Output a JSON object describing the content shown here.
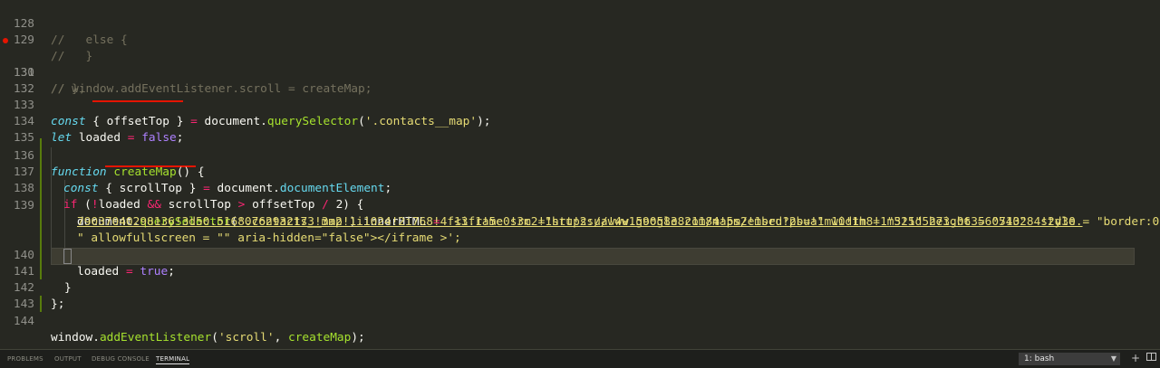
{
  "editor": {
    "gutter": [
      "128",
      "129",
      "130",
      "131",
      "132",
      "133",
      "134",
      "135",
      "136",
      "137",
      "138",
      "139",
      "",
      "",
      "140",
      "141",
      "142",
      "143",
      "144"
    ],
    "lines": {
      "l128": "//   else {",
      "l129": "//   }",
      "l130": "// };",
      "l131": "// window.addEventListener.scroll = createMap;",
      "l133": {
        "kw": "const",
        "open": " { ",
        "name": "offsetTop",
        "close": " } ",
        "eq": "=",
        "obj": " document.",
        "method": "querySelector",
        "p1": "(",
        "arg": "'.contacts__map'",
        "p2": ");"
      },
      "l134": {
        "kw": "let",
        "name": " loaded ",
        "eq": "=",
        "sp": " ",
        "val": "false",
        "end": ";"
      },
      "l136": {
        "kw": "function",
        "sp": " ",
        "name": "createMap",
        "rest": "() {"
      },
      "l137": {
        "kw": "const",
        "open": " { ",
        "name": "scrollTop",
        "close": " } ",
        "eq": "=",
        "obj": " document.",
        "prop": "documentElement",
        "end": ";"
      },
      "l138": {
        "kw": "if",
        "p": " (",
        "not": "!",
        "a": "loaded ",
        "and": "&&",
        "b": " scrollTop ",
        "gt": ">",
        "c": " offsetTop ",
        "div": "/",
        "d": " 2) {"
      },
      "l139a": {
        "obj": "document.",
        "method": "querySelector",
        "p1": "(",
        "arg": "'.contacts__map'",
        "p2": ").innerHTML ",
        "eq": "=",
        "sp": " ",
        "s1": "'<iframe src =\"",
        "url1": "https://www.google.com/maps/embed?pb=!1m10!1m8!1m3!1d5273.063560713284!2d30."
      },
      "l139b": {
        "url2": "79037040298136!3d50.51680762932173!3m2!1i1024!2i768!4f13.1!5e0!3m2!1sru!2sua!4v1590583821184!5m2!1sru!2sua",
        "s2": "\" width = \"525\" height = \"540\"  style = \"border:0;"
      },
      "l139c": "\" allowfullscreen = \"\" aria-hidden=\"false\"></iframe >';",
      "l140": {
        "name": "loaded ",
        "eq": "=",
        "sp": " ",
        "val": "true",
        "end": ";"
      },
      "l141": "}",
      "l142": "};",
      "l144": {
        "obj": "window.",
        "method": "addEventListener",
        "p1": "(",
        "arg": "'scroll'",
        "mid": ", ",
        "fn": "createMap",
        "end": ");"
      }
    }
  },
  "panel": {
    "tabs": [
      "PROBLEMS",
      "OUTPUT",
      "DEBUG CONSOLE",
      "TERMINAL"
    ],
    "active_tab": "TERMINAL",
    "terminal_select": "1: bash",
    "icons": [
      "chevron-down-icon",
      "plus-icon",
      "split-terminal-icon"
    ]
  },
  "colors": {
    "background": "#272822",
    "comment": "#75715e",
    "keyword": "#66d9ef",
    "operator": "#f92672",
    "function": "#a6e22e",
    "string": "#e6db74",
    "boolean": "#ae81ff",
    "annotation_underline": "#e51400"
  }
}
